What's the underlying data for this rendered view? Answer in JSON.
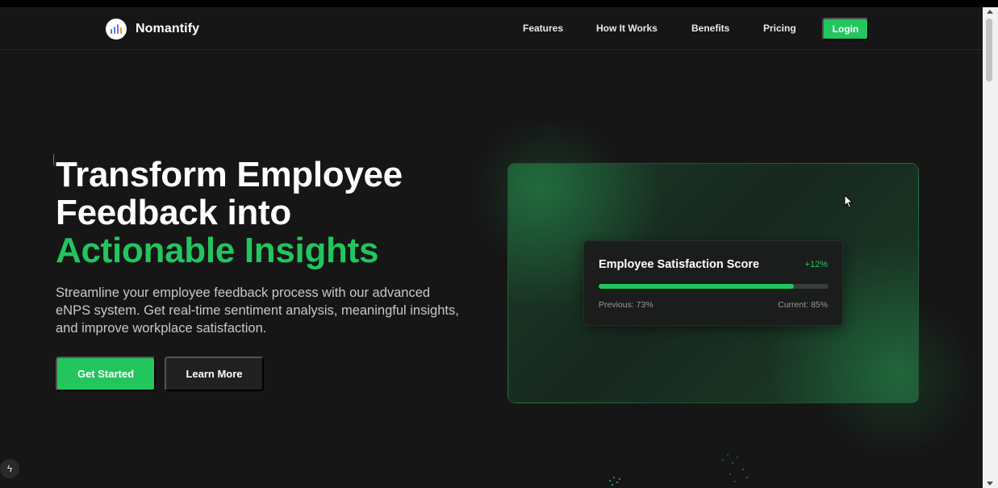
{
  "brand": {
    "name": "Nomantify",
    "logo_icon": "bar-chart-icon"
  },
  "nav": {
    "links": [
      "Features",
      "How It Works",
      "Benefits",
      "Pricing"
    ],
    "login_label": "Login"
  },
  "hero": {
    "headline_line1": "Transform Employee",
    "headline_line2": "Feedback into",
    "headline_accent": "Actionable Insights",
    "subtitle": "Streamline your employee feedback process with our advanced eNPS system. Get real-time sentiment analysis, meaningful insights, and improve workplace satisfaction.",
    "primary_cta": "Get Started",
    "secondary_cta": "Learn More"
  },
  "score_card": {
    "title": "Employee Satisfaction Score",
    "delta": "+12%",
    "progress_percent": 85,
    "previous_label": "Previous: 73%",
    "current_label": "Current: 85%"
  },
  "colors": {
    "accent": "#22c55e",
    "background": "#161616",
    "text": "#ffffff"
  }
}
